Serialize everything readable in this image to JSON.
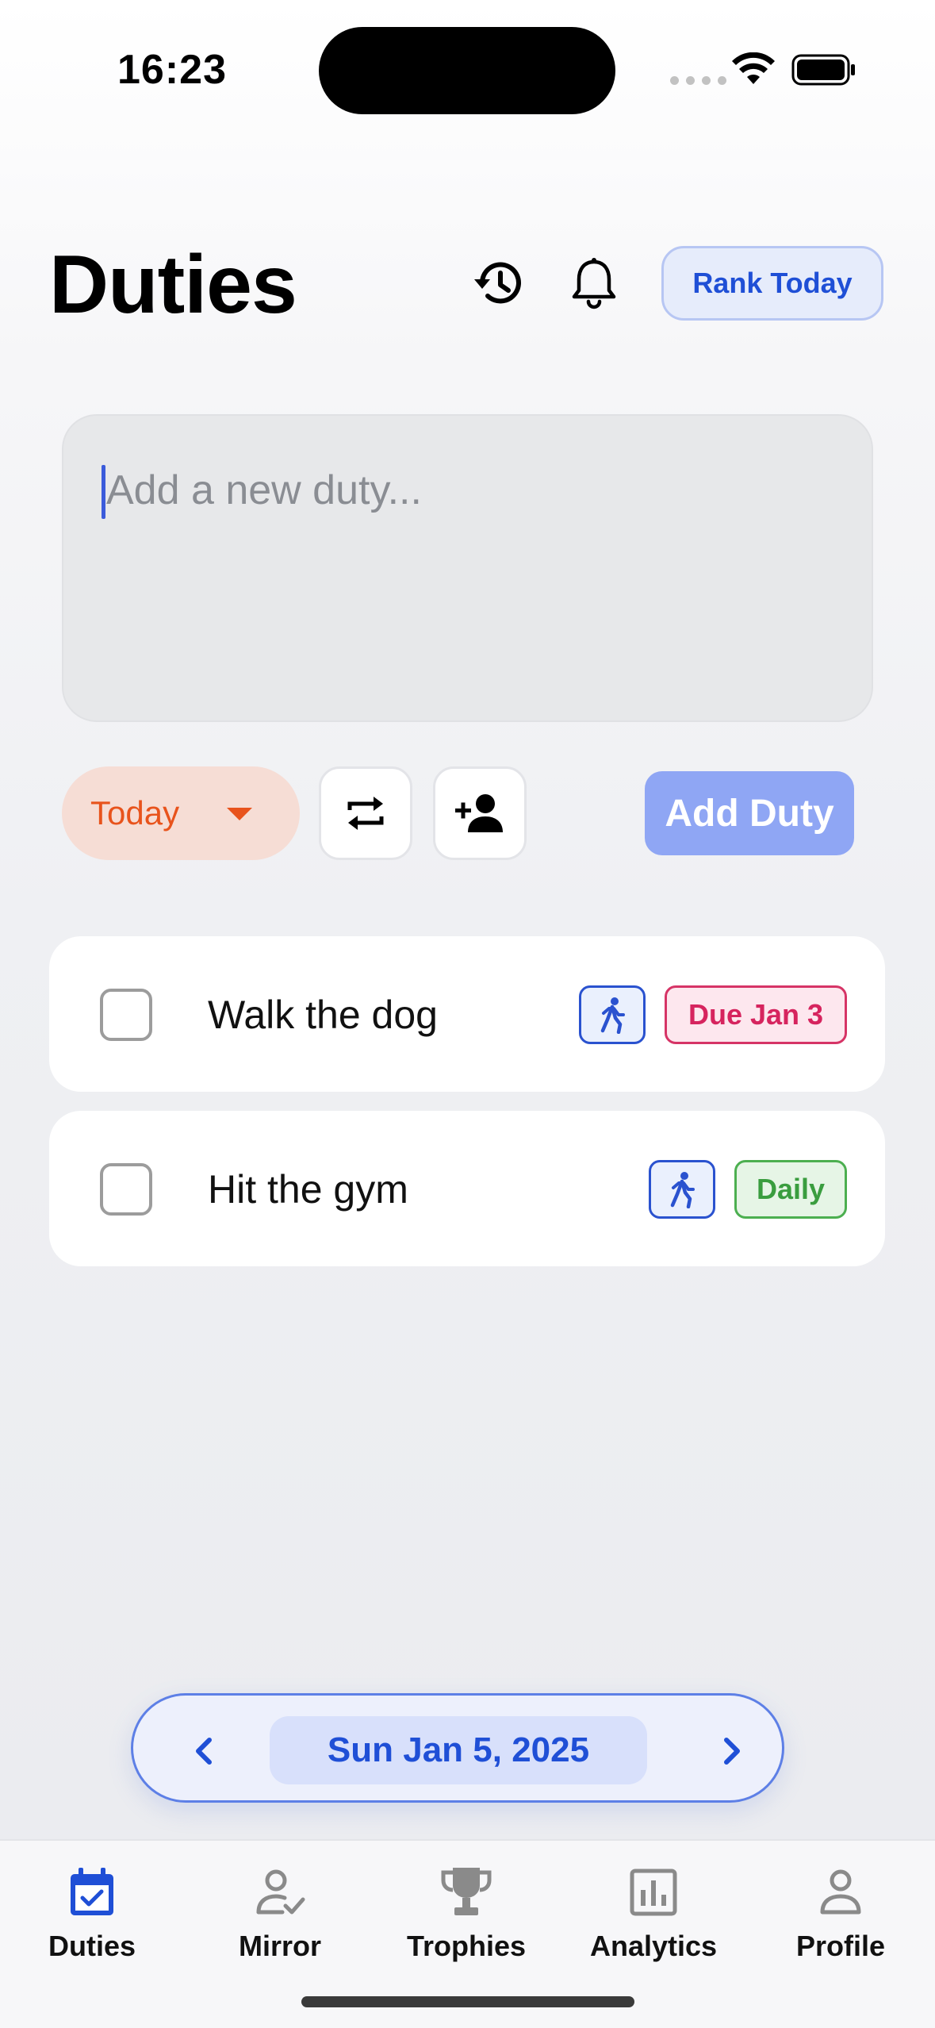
{
  "status_bar": {
    "time": "16:23"
  },
  "header": {
    "title": "Duties",
    "rank_button_label": "Rank Today"
  },
  "composer": {
    "placeholder": "Add a new duty...",
    "date_option": "Today",
    "add_button_label": "Add Duty"
  },
  "duties": [
    {
      "label": "Walk the dog",
      "activity_icon": "running-person-icon",
      "tag": "Due Jan 3",
      "tag_color": "#d6245e",
      "checked": false
    },
    {
      "label": "Hit the gym",
      "activity_icon": "running-person-icon",
      "tag": "Daily",
      "tag_color": "#3a9d3f",
      "checked": false
    }
  ],
  "date_navigator": {
    "current_date": "Sun Jan 5, 2025"
  },
  "tab_bar": {
    "active": "Duties",
    "tabs": [
      {
        "label": "Duties",
        "icon": "calendar-check-icon"
      },
      {
        "label": "Mirror",
        "icon": "person-check-icon"
      },
      {
        "label": "Trophies",
        "icon": "trophy-icon"
      },
      {
        "label": "Analytics",
        "icon": "bar-chart-icon"
      },
      {
        "label": "Profile",
        "icon": "person-icon"
      }
    ]
  },
  "colors": {
    "accent": "#1f4fd6",
    "add_button": "#8fa6f4",
    "today_pill_bg": "#f6ddd5",
    "today_pill_text": "#e8531c"
  }
}
